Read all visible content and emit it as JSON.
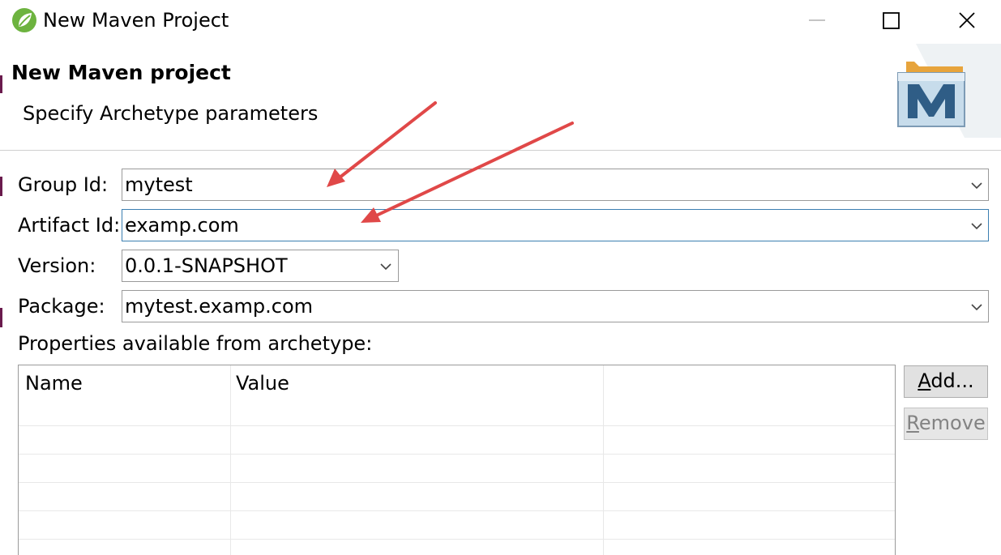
{
  "window": {
    "title": "New Maven Project",
    "icon": "spring-leaf-icon"
  },
  "header": {
    "title": "New Maven project",
    "description": "Specify Archetype parameters",
    "logo": "maven-m-icon"
  },
  "form": {
    "group_id": {
      "label": "Group Id:",
      "value": "mytest"
    },
    "artifact_id": {
      "label": "Artifact Id:",
      "value": "examp.com"
    },
    "version": {
      "label": "Version:",
      "value": "0.0.1-SNAPSHOT"
    },
    "package": {
      "label": "Package:",
      "value": "mytest.examp.com"
    }
  },
  "properties": {
    "label": "Properties available from archetype:",
    "columns": [
      "Name",
      "Value"
    ],
    "rows": []
  },
  "buttons": {
    "add": {
      "mnemonic": "A",
      "rest": "dd..."
    },
    "remove": {
      "mnemonic": "R",
      "rest": "emove"
    }
  },
  "colors": {
    "annotation_arrow": "#e04848",
    "focus_border": "#3c7fb1",
    "spring_green": "#6db33f"
  }
}
